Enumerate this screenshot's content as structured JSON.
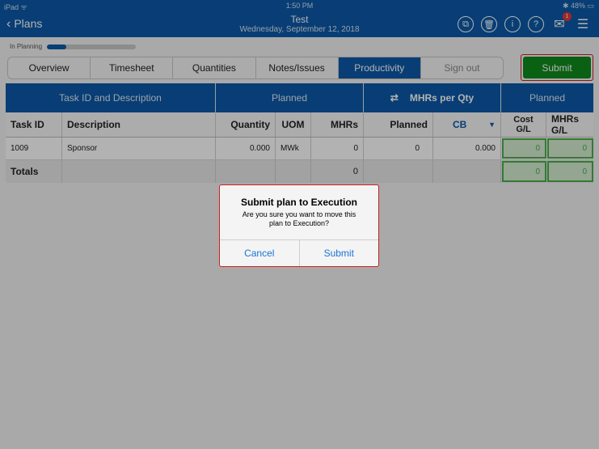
{
  "status": {
    "left": "iPad ᯤ",
    "time": "1:50 PM",
    "battery": "✱ 48% ▭"
  },
  "nav": {
    "back_label": "Plans",
    "title": "Test",
    "subtitle": "Wednesday, September 12, 2018",
    "icons": [
      "copy-icon",
      "trash-icon",
      "info-icon",
      "help-icon",
      "notification-icon",
      "menu-icon"
    ],
    "notification_count": "1"
  },
  "progress": {
    "label": "In Planning",
    "fraction": 0.22
  },
  "tabs": [
    "Overview",
    "Timesheet",
    "Quantities",
    "Notes/Issues",
    "Productivity",
    "Sign out"
  ],
  "active_tab": "Productivity",
  "submit_label": "Submit",
  "table": {
    "group_headers": {
      "task": "Task ID and Description",
      "planned": "Planned",
      "mhrs_per_qty": "MHRs per Qty",
      "planned2": "Planned"
    },
    "columns": {
      "task_id": "Task ID",
      "description": "Description",
      "quantity": "Quantity",
      "uom": "UOM",
      "mhrs": "MHRs",
      "planned": "Planned",
      "cb": "CB",
      "cost_gl": "Cost G/L",
      "mhrs_gl": "MHRs G/L"
    },
    "row": {
      "task_id": "1009",
      "description": "Sponsor",
      "quantity": "0.000",
      "uom": "MWk",
      "mhrs": "0",
      "planned": "0",
      "cb": "0.000",
      "cost_gl": "0",
      "mhrs_gl": "0"
    },
    "totals": {
      "label": "Totals",
      "mhrs": "0",
      "cost_gl": "0",
      "mhrs_gl": "0"
    }
  },
  "dialog": {
    "title": "Submit plan to Execution",
    "message": "Are you sure you want to move this plan to Execution?",
    "cancel": "Cancel",
    "confirm": "Submit"
  },
  "colors": {
    "brand": "#0c5aa8",
    "submit": "#0f8a1c",
    "link": "#1a73d9",
    "highlight": "#cc2020"
  }
}
